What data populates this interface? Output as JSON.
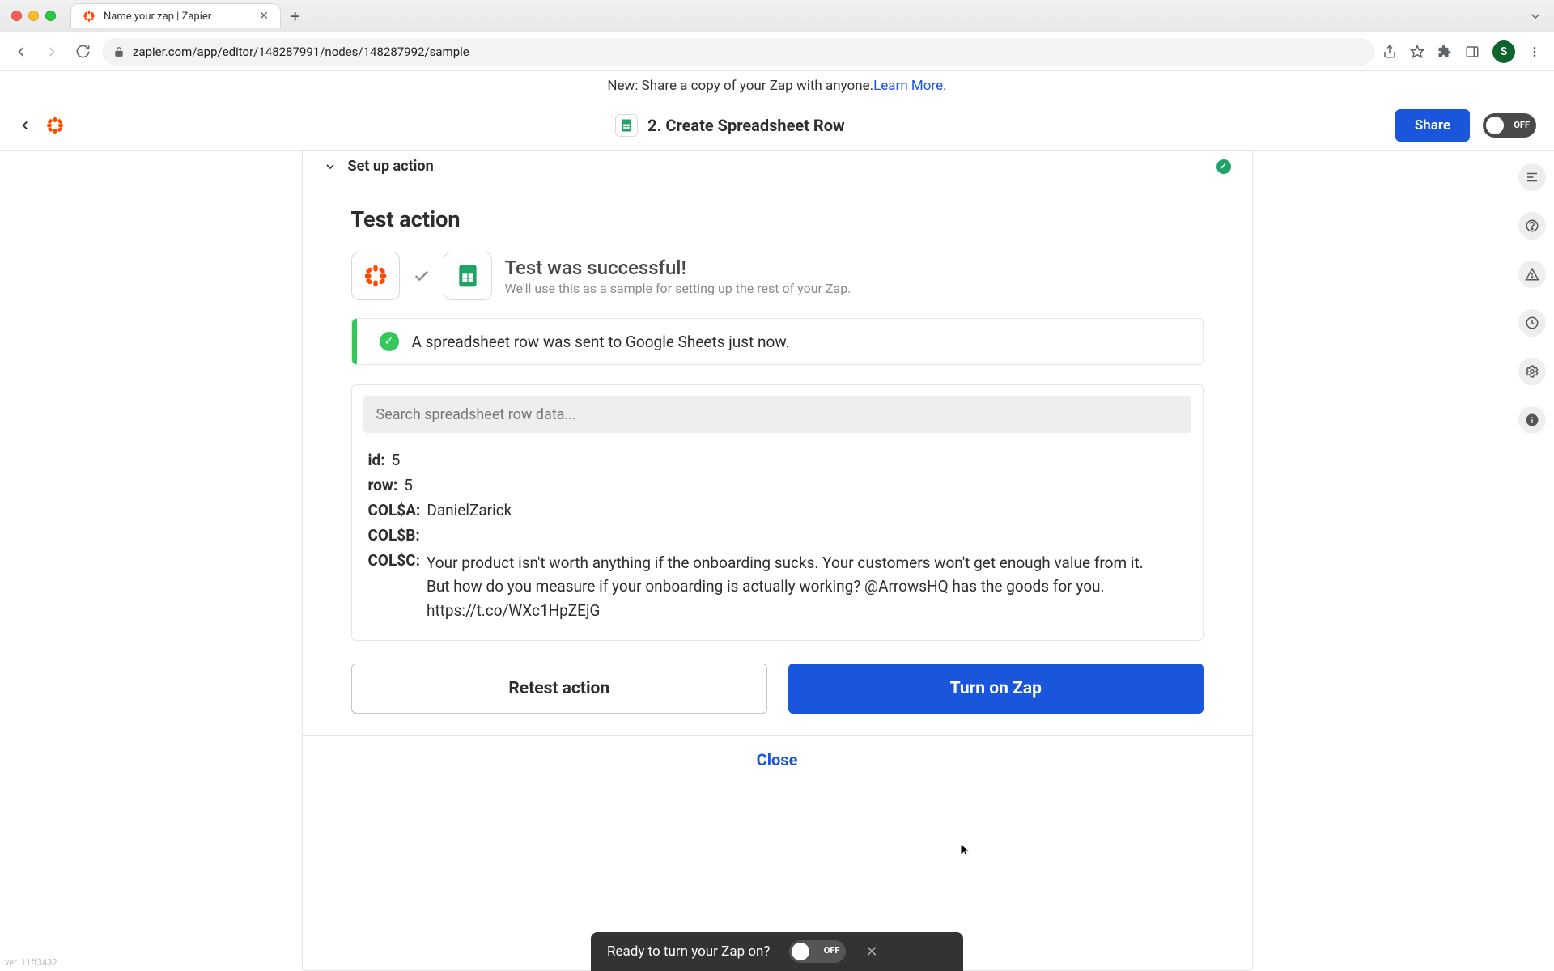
{
  "browser": {
    "tab_title": "Name your zap | Zapier",
    "url": "zapier.com/app/editor/148287991/nodes/148287992/sample",
    "avatar_letter": "S"
  },
  "announce": {
    "prefix": "New: Share a copy of your Zap with anyone. ",
    "link": "Learn More",
    "suffix": "."
  },
  "header": {
    "step_title": "2. Create Spreadsheet Row",
    "share": "Share",
    "toggle_label": "OFF"
  },
  "panel": {
    "accordion_label": "Set up action",
    "section_title": "Test action",
    "success_title": "Test was successful!",
    "success_sub": "We'll use this as a sample for setting up the rest of your Zap.",
    "toast": "A spreadsheet row was sent to Google Sheets just now.",
    "search_placeholder": "Search spreadsheet row data...",
    "data": [
      {
        "key": "id:",
        "val": "5"
      },
      {
        "key": "row:",
        "val": "5"
      },
      {
        "key": "COL$A:",
        "val": "DanielZarick"
      },
      {
        "key": "COL$B:",
        "val": ""
      },
      {
        "key": "COL$C:",
        "val": "Your product isn't worth anything if the onboarding sucks. Your customers won't get enough value from it.\nBut how do you measure if your onboarding is actually working? @ArrowsHQ has the goods for you. https://t.co/WXc1HpZEjG"
      }
    ],
    "retest": "Retest action",
    "turnon": "Turn on Zap",
    "close": "Close"
  },
  "bottom_toast": {
    "text": "Ready to turn your Zap on?",
    "label": "OFF"
  },
  "version": "ver. 11ff3432"
}
